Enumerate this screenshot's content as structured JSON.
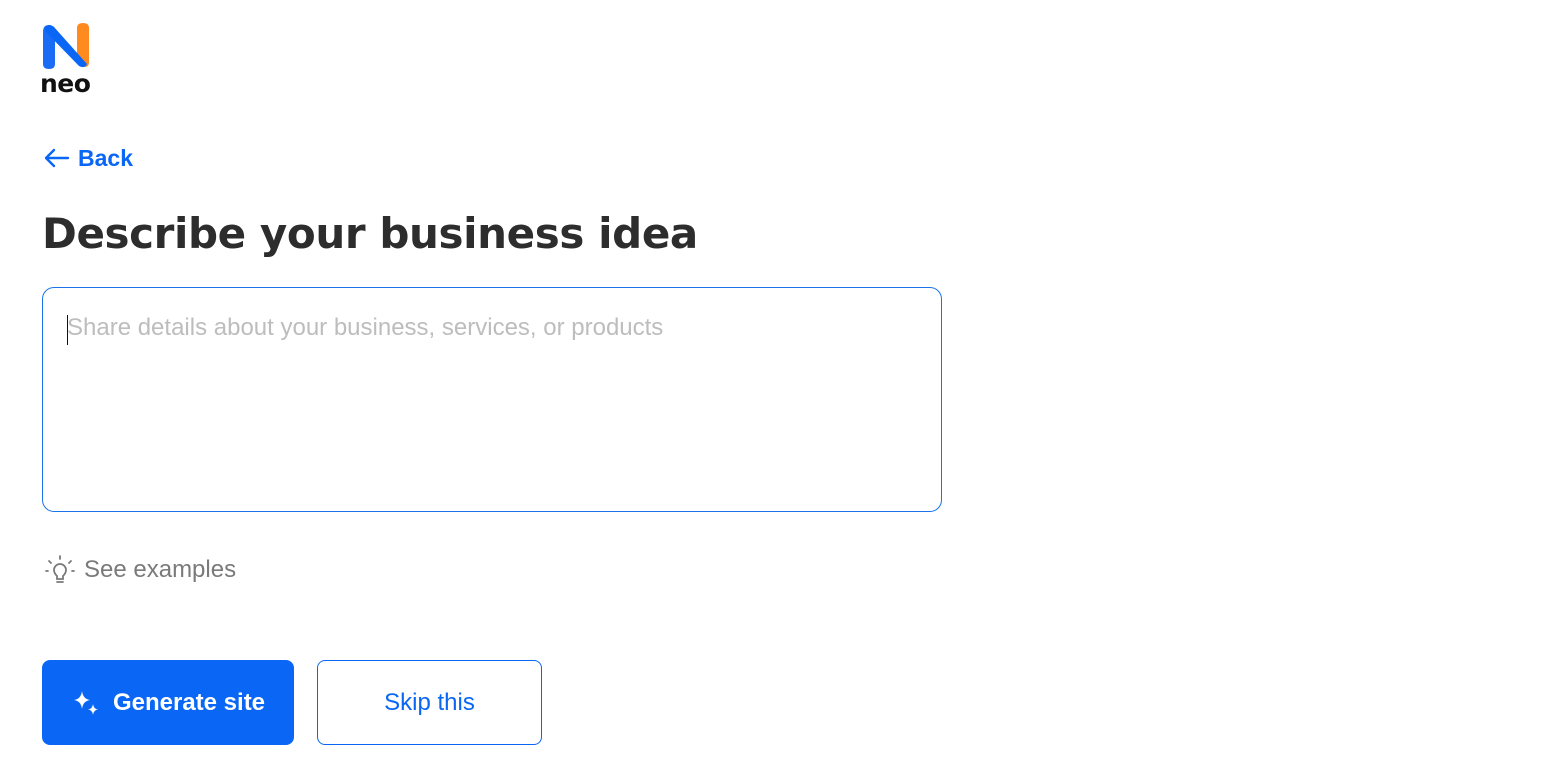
{
  "brand": {
    "logo_icon": "neo-logo-icon",
    "wordmark": "neo",
    "colors": {
      "blue": "#0a66f5",
      "orange": "#ff8a1e"
    }
  },
  "nav": {
    "back_label": "Back",
    "back_icon": "arrow-left-icon"
  },
  "main": {
    "title": "Describe your business idea",
    "description_field": {
      "placeholder": "Share details about your business, services, or products",
      "value": ""
    },
    "examples": {
      "label": "See examples",
      "icon": "lightbulb-icon"
    }
  },
  "actions": {
    "generate_label": "Generate site",
    "generate_icon": "sparkles-icon",
    "skip_label": "Skip this"
  },
  "colors": {
    "accent": "#0a66f5",
    "title": "#2d2d2d",
    "muted": "#7a7a7a",
    "placeholder": "#bdbdbd"
  }
}
